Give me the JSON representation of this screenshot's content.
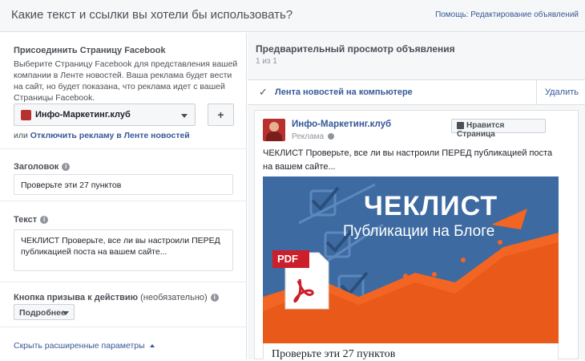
{
  "header": {
    "title": "Какие текст и ссылки вы хотели бы использовать?",
    "help_link": "Помощь: Редактирование объявлений"
  },
  "page_section": {
    "label": "Присоединить Страницу Facebook",
    "description": "Выберите Страницу Facebook для представления вашей компании в Ленте новостей. Ваша реклама будет вести на сайт, но будет показана, что реклама идет с вашей Страницы Facebook.",
    "selected_page": "Инфо-Маркетинг.клуб",
    "add_button": "+",
    "or_text": "или",
    "disable_link": "Отключить рекламу в Ленте новостей"
  },
  "headline_section": {
    "label": "Заголовок",
    "value": "Проверьте эти 27 пунктов"
  },
  "text_section": {
    "label": "Текст",
    "value": "ЧЕКЛИСТ Проверьте, все ли вы настроили ПЕРЕД публикацией поста на вашем сайте..."
  },
  "cta_section": {
    "label": "Кнопка призыва к действию",
    "optional": "(необязательно)",
    "selected": "Подробнее"
  },
  "advanced_link": "Скрыть расширенные параметры",
  "preview": {
    "title": "Предварительный просмотр объявления",
    "counter": "1 из 1",
    "placement": "Лента новостей на компьютере",
    "remove": "Удалить",
    "page_name": "Инфо-Маркетинг.клуб",
    "sponsored": "Реклама",
    "like_button": "Нравится Страница",
    "post_text": "ЧЕКЛИСТ Проверьте, все ли вы настроили ПЕРЕД публикацией поста на вашем сайте...",
    "image_title": "ЧЕКЛИСТ",
    "image_subtitle": "Публикации на Блоге",
    "pdf_label": "PDF",
    "link_headline": "Проверьте эти 27 пунктов"
  },
  "colors": {
    "link": "#365899",
    "image_bg": "#3d6aa0",
    "accent_orange": "#f26522"
  }
}
